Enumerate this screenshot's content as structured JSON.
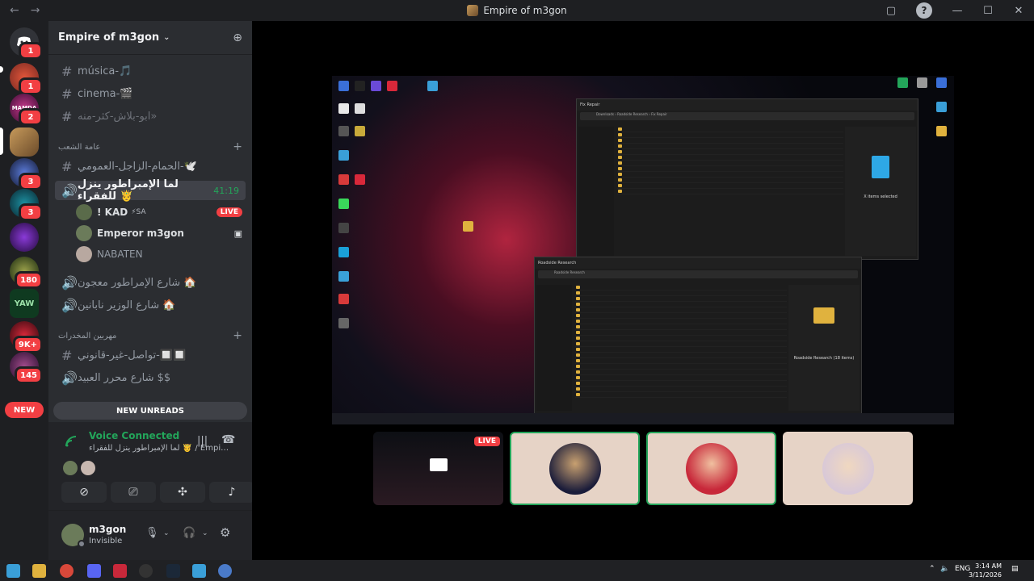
{
  "window": {
    "title": "Empire of m3gon"
  },
  "rail": {
    "servers": [
      {
        "label": "",
        "badge": "1"
      },
      {
        "label": "",
        "badge": "1"
      },
      {
        "label": "MAMDA",
        "badge": "2"
      },
      {
        "label": "",
        "badge": ""
      },
      {
        "label": "",
        "badge": "3"
      },
      {
        "label": "",
        "badge": "3"
      },
      {
        "label": "",
        "badge": ""
      },
      {
        "label": "",
        "badge": "180"
      },
      {
        "label": "YAW",
        "badge": ""
      },
      {
        "label": "",
        "badge": "9K+"
      },
      {
        "label": "",
        "badge": "145"
      }
    ],
    "new_label": "NEW"
  },
  "server": {
    "name": "Empire of m3gon",
    "channels": [
      {
        "name": "música-🎵",
        "type": "text"
      },
      {
        "name": "cinema-🎬",
        "type": "text"
      },
      {
        "name": "ابو-بلاش-كثر-منه»",
        "type": "text"
      }
    ],
    "category1": "عامة الشعب",
    "channels2": [
      {
        "name": "الحمام-الزاجل-العمومي-🕊️",
        "type": "text"
      },
      {
        "name": "لما الإمبراطور ينزل للفقراء 🤴",
        "type": "voice",
        "time": "41:19"
      }
    ],
    "voice_users": [
      {
        "name": "! KAD",
        "tag": "⚡SA",
        "live": "LIVE"
      },
      {
        "name": "Emperor m3gon",
        "tag": "",
        "live": ""
      },
      {
        "name": "NABATEN",
        "tag": "",
        "live": ""
      }
    ],
    "channels3": [
      {
        "name": "شارع الإمراطور معجون 🏠",
        "type": "voice"
      },
      {
        "name": "شارع الوزير نابانين 🏠",
        "type": "voice"
      }
    ],
    "category2": "مهربين المخدرات",
    "channels4": [
      {
        "name": "تواصل-غير-قانوني-🔲🔲",
        "type": "text"
      },
      {
        "name": "شارع محرر العبيد $$",
        "type": "voice"
      }
    ],
    "new_unreads": "NEW UNREADS"
  },
  "voice": {
    "status": "Voice Connected",
    "location": "لما الإمبراطور ينزل للفقراء 🤴 / Empire of m3g..."
  },
  "user": {
    "name": "m3gon",
    "status": "Invisible"
  },
  "stage": {
    "live_label": "LIVE",
    "explorer1": {
      "title": "Fix Repair",
      "path": "Downloads › Roadside Research › Fix Repair",
      "preview": "X items selected"
    },
    "explorer2": {
      "title": "Roadside Research",
      "path": "Roadside Research",
      "preview": "Roadside Research (18 items)"
    }
  },
  "taskbar": {
    "lang": "ENG",
    "time": "3:14 AM",
    "date": "3/11/2026"
  }
}
